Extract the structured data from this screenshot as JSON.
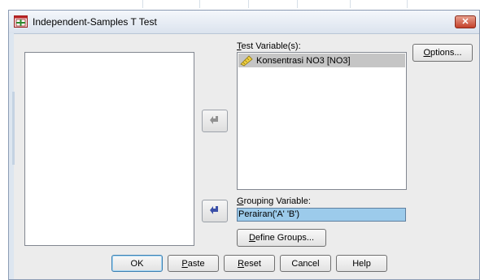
{
  "window": {
    "title": "Independent-Samples T Test",
    "close_label": "✕"
  },
  "test_variables": {
    "label_underlined": "T",
    "label_rest": "est Variable(s):",
    "items": [
      {
        "label": "Konsentrasi NO3 [NO3]",
        "icon": "ruler-icon"
      }
    ]
  },
  "grouping": {
    "label_underlined": "G",
    "label_rest": "rouping Variable:",
    "value": "Perairan('A' 'B')"
  },
  "side_buttons": {
    "options_underlined": "O",
    "options_rest": "ptions...",
    "define_groups_underlined": "D",
    "define_groups_rest": "efine Groups..."
  },
  "footer": {
    "ok": "OK",
    "paste_underlined": "P",
    "paste_rest": "aste",
    "reset_underlined": "R",
    "reset_rest": "eset",
    "cancel": "Cancel",
    "help": "Help"
  },
  "colors": {
    "dialog_bg": "#ececec",
    "selected_item": "#c5c5c5",
    "grouping_highlight": "#9ccbeb",
    "arrow_active": "#3a4fa8",
    "arrow_disabled": "#8d8d8d"
  }
}
